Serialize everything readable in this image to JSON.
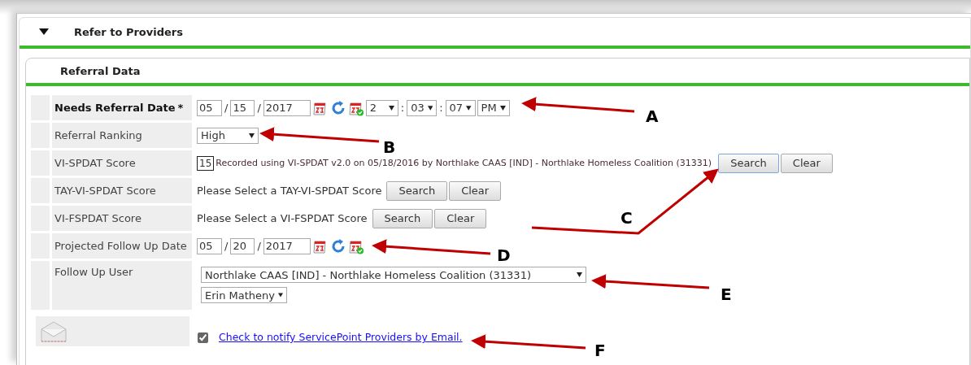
{
  "section": {
    "title": "Refer to Providers",
    "expanded": true
  },
  "panel": {
    "title": "Referral Data"
  },
  "rows": [
    {
      "kind": "datetime",
      "label": "Needs Referral Date",
      "required_mark": "*",
      "month": "05",
      "date_separators": [
        "/",
        "/"
      ],
      "day": "15",
      "year": "2017",
      "hour": "2",
      "time_separators": [
        ":",
        ":"
      ],
      "minute": "03",
      "second": "07",
      "ampm": "PM"
    },
    {
      "kind": "select",
      "label": "Referral Ranking",
      "value": "High"
    },
    {
      "kind": "score",
      "label": "VI-SPDAT Score",
      "score": "15",
      "text": "Recorded using VI-SPDAT v2.0 on 05/18/2016 by Northlake CAAS [IND] - Northlake Homeless Coalition (31331)",
      "search": "Search",
      "clear": "Clear",
      "focused": true
    },
    {
      "kind": "score",
      "label": "TAY-VI-SPDAT Score",
      "text": "Please Select a TAY-VI-SPDAT Score",
      "search": "Search",
      "clear": "Clear",
      "focused": false
    },
    {
      "kind": "score",
      "label": "VI-FSPDAT Score",
      "text": "Please Select a VI-FSPDAT Score",
      "search": "Search",
      "clear": "Clear",
      "focused": false
    },
    {
      "kind": "date",
      "label": "Projected Follow Up Date",
      "month": "05",
      "date_separators": [
        "/",
        "/"
      ],
      "day": "20",
      "year": "2017"
    },
    {
      "kind": "user",
      "label": "Follow Up User",
      "provider": "Northlake CAAS [IND] - Northlake Homeless Coalition (31331)",
      "user": "Erin Matheny"
    }
  ],
  "notify": {
    "checked": true,
    "link": "Check to notify ServicePoint Providers by Email."
  },
  "callouts": [
    {
      "letter": "A"
    },
    {
      "letter": "B"
    },
    {
      "letter": "C"
    },
    {
      "letter": "D"
    },
    {
      "letter": "E"
    },
    {
      "letter": "F"
    }
  ]
}
